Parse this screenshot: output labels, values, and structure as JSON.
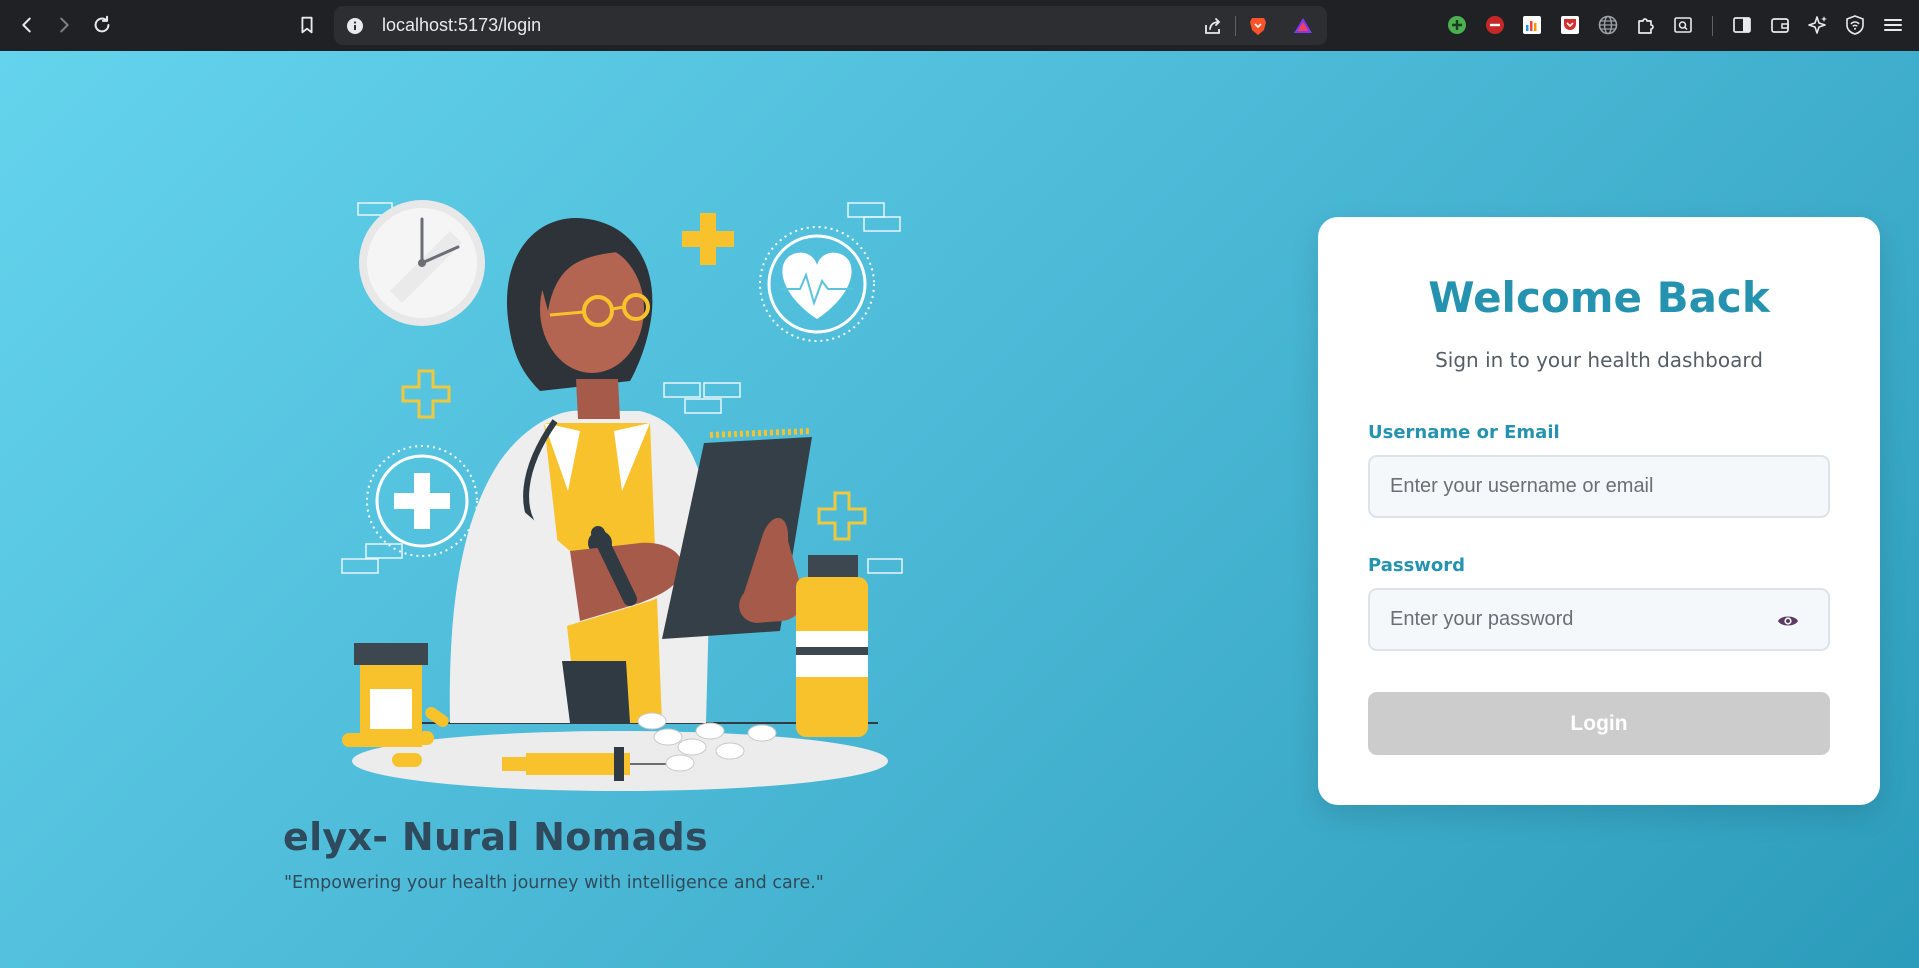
{
  "browser": {
    "url": "localhost:5173/login",
    "back_icon": "arrow-left-icon",
    "forward_icon": "arrow-right-icon",
    "reload_icon": "reload-icon"
  },
  "brand": {
    "title": "elyx- Nural Nomads",
    "tagline": "\"Empowering your health journey with intelligence and care.\""
  },
  "login": {
    "title": "Welcome Back",
    "subtitle": "Sign in to your health dashboard",
    "username_label": "Username or Email",
    "username_placeholder": "Enter your username or email",
    "password_label": "Password",
    "password_placeholder": "Enter your password",
    "submit_label": "Login"
  },
  "colors": {
    "accent": "#2593b0",
    "background_start": "#64d3ec",
    "background_end": "#2c9cbb",
    "button_disabled": "#cccccc"
  }
}
